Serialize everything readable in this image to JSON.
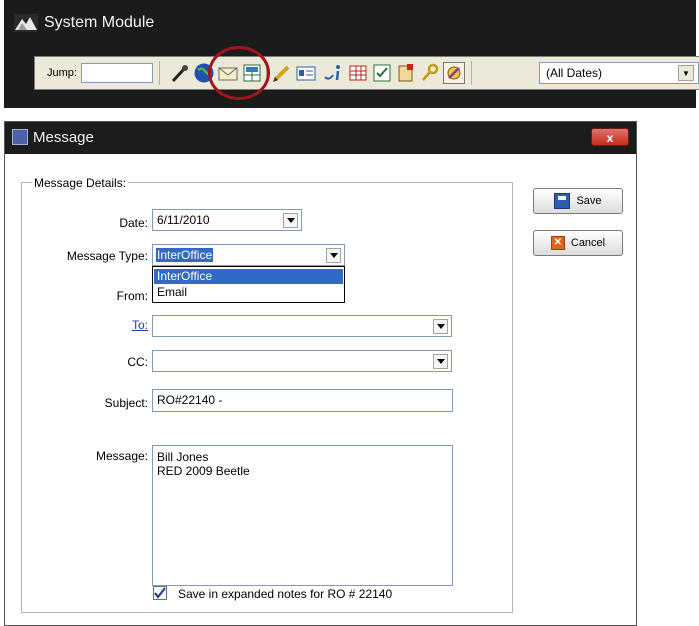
{
  "system_module": {
    "title": "System Module",
    "toolbar": {
      "jump_label": "Jump:",
      "jump_value": "",
      "date_filter": "(All Dates)",
      "icons": [
        "pen-icon",
        "globe-icon",
        "envelope-icon",
        "table-icon",
        "pencil-icon",
        "card-icon",
        "info-icon",
        "grid-icon",
        "checklist-icon",
        "clipboard-icon",
        "key-icon",
        "tools-icon"
      ]
    }
  },
  "dialog": {
    "title": "Message",
    "close_label": "x",
    "group_title": "Message Details:",
    "date": {
      "label": "Date:",
      "value": "6/11/2010"
    },
    "message_type": {
      "label": "Message Type:",
      "value": "InterOffice",
      "options": [
        "InterOffice",
        "Email"
      ]
    },
    "from": {
      "label": "From:"
    },
    "to": {
      "label": "To:",
      "value": ""
    },
    "cc": {
      "label": "CC:",
      "value": ""
    },
    "subject": {
      "label": "Subject:",
      "value": "RO#22140 -"
    },
    "message": {
      "label": "Message:",
      "lines": [
        "Bill Jones",
        "RED 2009 Beetle"
      ]
    },
    "save_expanded": {
      "label": "Save in expanded notes for RO # 22140",
      "checked": true
    },
    "buttons": {
      "save": "Save",
      "cancel": "Cancel"
    }
  },
  "colors": {
    "titlebar": "#1c1c1c",
    "link": "#1a3fb0",
    "selection": "#3169c6",
    "highlight_circle": "#a0161b"
  }
}
